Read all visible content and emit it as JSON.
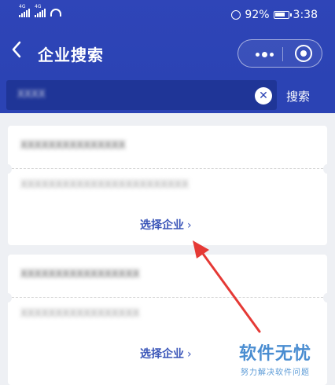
{
  "status_bar": {
    "signal1": "4G",
    "signal2": "4G",
    "battery_pct": "92%",
    "time": "3:38"
  },
  "nav": {
    "back_icon": "chevron-left-icon",
    "title": "企业搜索"
  },
  "search": {
    "value": "XXXX",
    "search_label": "搜索",
    "clear_icon": "close-icon"
  },
  "results": [
    {
      "name": "XXXXXXXXXXXXXXX",
      "address": "XXXXXXXXXXXXXXXXXXXXXXXX",
      "select_label": "选择企业",
      "chevron": "›"
    },
    {
      "name": "XXXXXXXXXXXXXXXXX",
      "address": "XXXXXXXXXXXXXXXXX",
      "select_label": "选择企业",
      "chevron": "›"
    }
  ],
  "watermark": {
    "main": "软件无忧",
    "sub": "努力解决软件问题"
  },
  "colors": {
    "header_bg": "#2b43b4",
    "search_box_bg": "#1f3597",
    "accent_link": "#3a55b8",
    "annotation_arrow": "#e53935",
    "page_bg": "#eef0f4"
  }
}
